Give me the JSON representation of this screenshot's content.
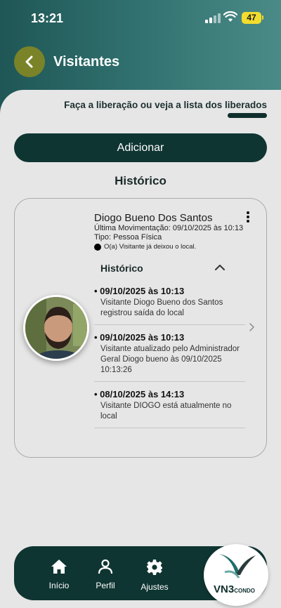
{
  "status_bar": {
    "time": "13:21",
    "battery": "47"
  },
  "header": {
    "title": "Visitantes",
    "back_icon": "chevron-left-icon"
  },
  "subtitle": "Faça a liberação ou veja a lista dos liberados",
  "add_button": "Adicionar",
  "section_title": "Histórico",
  "visitor": {
    "name": "Diogo Bueno Dos Santos",
    "last_movement": "Última Movimentação: 09/10/2025 às 10:13",
    "type": "Tipo: Pessoa Física",
    "status": "O(a) Visitante já deixou o local.",
    "history_label": "Histórico",
    "history": [
      {
        "date": "09/10/2025 às 10:13",
        "text": "Visitante Diogo Bueno dos Santos registrou saída do local"
      },
      {
        "date": "09/10/2025 às 10:13",
        "text": "Visitante atualizado pelo Administrador Geral Diogo bueno às 09/10/2025 10:13:26"
      },
      {
        "date": "08/10/2025 às 14:13",
        "text": "Visitante DIOGO está atualmente no local"
      }
    ]
  },
  "bottom_nav": {
    "items": [
      {
        "label": "Início",
        "icon": "home-icon"
      },
      {
        "label": "Perfil",
        "icon": "user-icon"
      },
      {
        "label": "Ajustes",
        "icon": "gear-icon"
      }
    ]
  },
  "logo": {
    "main": "VN3",
    "sub": "CONDO"
  },
  "colors": {
    "primary": "#0f3532",
    "header": "#2f6f6d",
    "back_button": "#7a8328",
    "background": "#e6e6e6"
  }
}
